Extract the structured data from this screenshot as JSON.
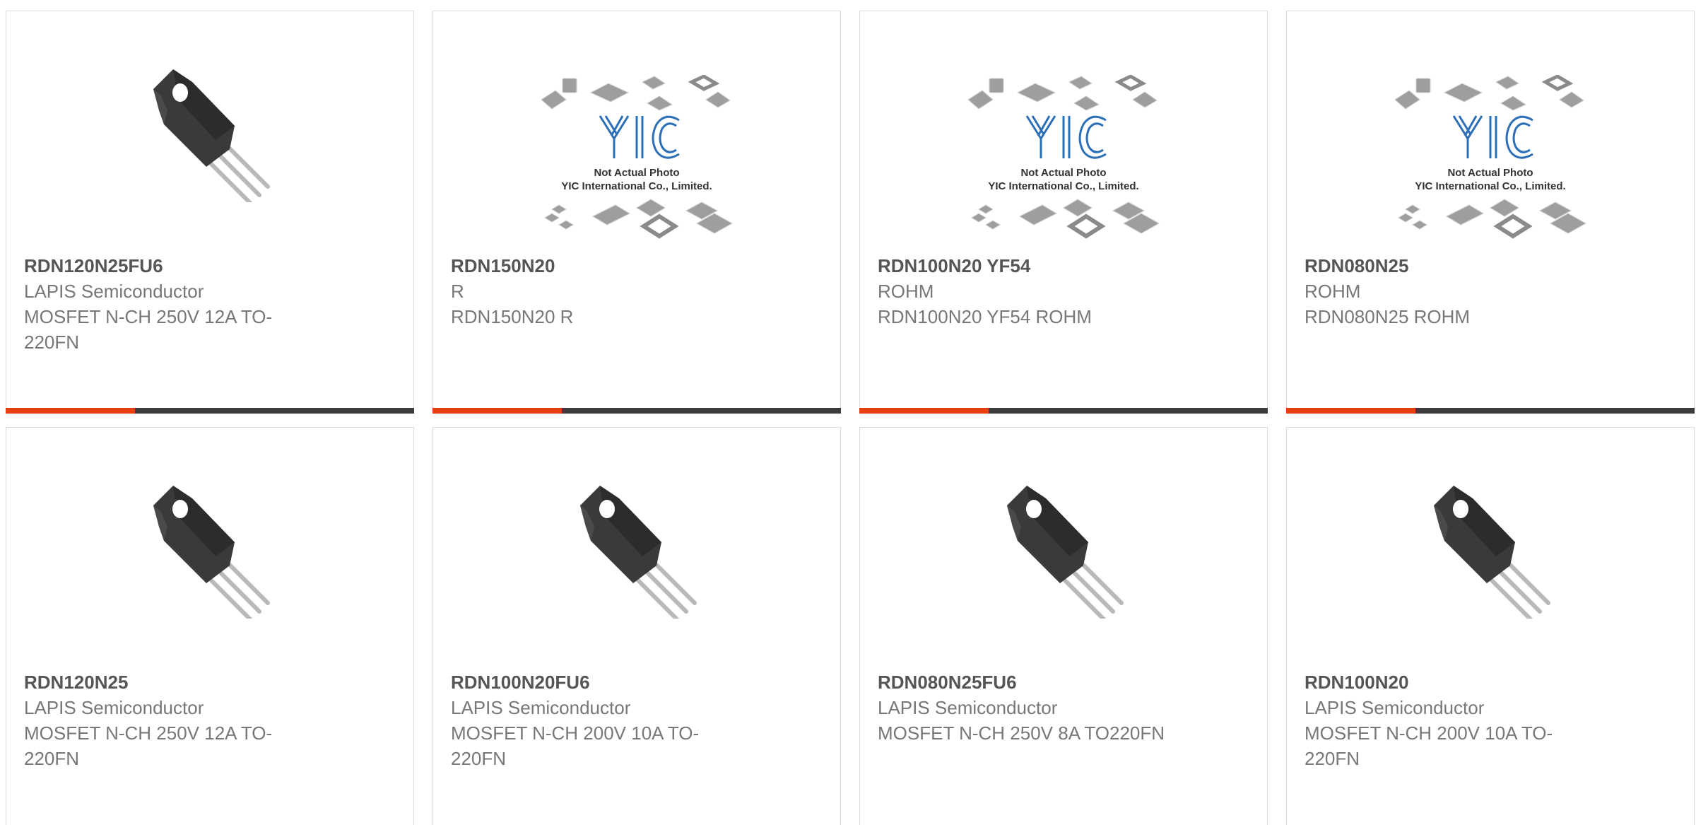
{
  "colors": {
    "accent": "#e8400c",
    "bar_dark": "#3c3c3c",
    "part_number": "#555555",
    "text": "#777777"
  },
  "products": [
    {
      "part_number": "RDN120N25FU6",
      "manufacturer": "LAPIS Semiconductor",
      "description": "MOSFET N-CH 250V 12A TO-220FN",
      "image": "mosfet-photo"
    },
    {
      "part_number": "RDN150N20",
      "manufacturer": "R",
      "description": "RDN150N20 R",
      "image": "placeholder",
      "placeholder_line1": "Not Actual Photo",
      "placeholder_line2": "YIC International Co., Limited."
    },
    {
      "part_number": "RDN100N20 YF54",
      "manufacturer": "ROHM",
      "description": "RDN100N20 YF54 ROHM",
      "image": "placeholder",
      "placeholder_line1": "Not Actual Photo",
      "placeholder_line2": "YIC International Co., Limited."
    },
    {
      "part_number": "RDN080N25",
      "manufacturer": "ROHM",
      "description": "RDN080N25 ROHM",
      "image": "placeholder",
      "placeholder_line1": "Not Actual Photo",
      "placeholder_line2": "YIC International Co., Limited."
    },
    {
      "part_number": "RDN120N25",
      "manufacturer": "LAPIS Semiconductor",
      "description": "MOSFET N-CH 250V 12A TO-220FN",
      "image": "mosfet-photo"
    },
    {
      "part_number": "RDN100N20FU6",
      "manufacturer": "LAPIS Semiconductor",
      "description": "MOSFET N-CH 200V 10A TO-220FN",
      "image": "mosfet-photo"
    },
    {
      "part_number": "RDN080N25FU6",
      "manufacturer": "LAPIS Semiconductor",
      "description": "MOSFET N-CH 250V 8A TO220FN",
      "image": "mosfet-photo"
    },
    {
      "part_number": "RDN100N20",
      "manufacturer": "LAPIS Semiconductor",
      "description": "MOSFET N-CH 200V 10A TO-220FN",
      "image": "mosfet-photo"
    }
  ]
}
